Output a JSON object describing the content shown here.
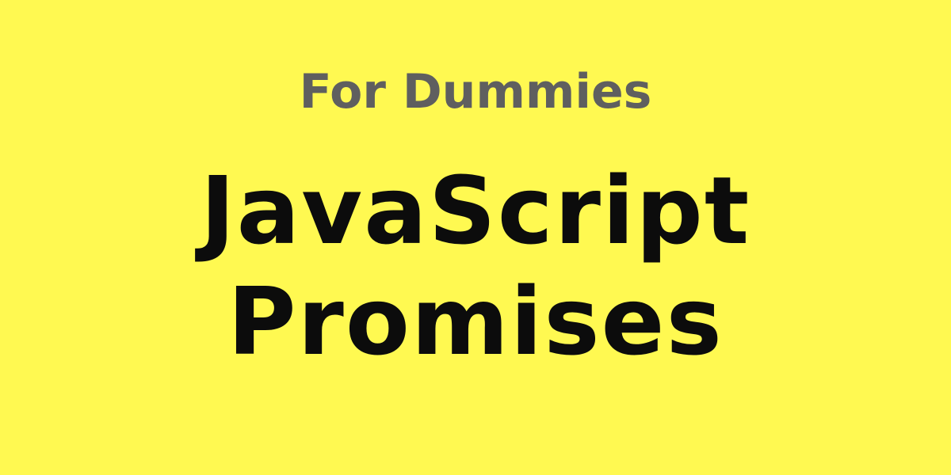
{
  "banner": {
    "subtitle": "For Dummies",
    "title_line_1": "JavaScript",
    "title_line_2": "Promises",
    "colors": {
      "background": "#fff951",
      "subtitle": "#5f5f5f",
      "title": "#0c0c0c"
    }
  }
}
